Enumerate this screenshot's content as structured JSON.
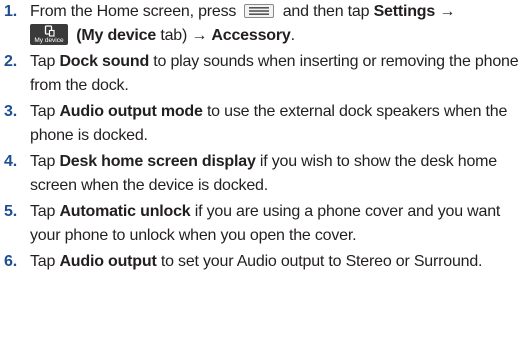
{
  "steps": [
    {
      "num": "1.",
      "line1_pre": "From the Home screen, press",
      "line1_mid": "and then tap",
      "settings": "Settings",
      "arrow1": "→",
      "my_device_icon_label": "My device",
      "my_device_tab": "(My device",
      "tab_word": "tab)",
      "arrow2": "→",
      "accessory": "Accessory",
      "end": "."
    },
    {
      "num": "2.",
      "pre": "Tap",
      "bold": "Dock sound",
      "post": "to play sounds when inserting or removing the phone from the dock."
    },
    {
      "num": "3.",
      "pre": "Tap",
      "bold": "Audio output mode",
      "post": "to use the external dock speakers when the phone is docked."
    },
    {
      "num": "4.",
      "pre": "Tap",
      "bold": "Desk home screen display",
      "post": "if you wish to show the desk home screen when the device is docked."
    },
    {
      "num": "5.",
      "pre": "Tap",
      "bold": "Automatic unlock",
      "post": "if you are using a phone cover and you want your phone to unlock when you open the cover."
    },
    {
      "num": "6.",
      "pre": "Tap",
      "bold": "Audio output",
      "post": "to set your Audio output to Stereo or Surround."
    }
  ],
  "icons": {
    "menu_key": "menu-key-icon",
    "my_device": "my-device-icon"
  },
  "colors": {
    "number": "#1f4e91",
    "text": "#231f20"
  }
}
